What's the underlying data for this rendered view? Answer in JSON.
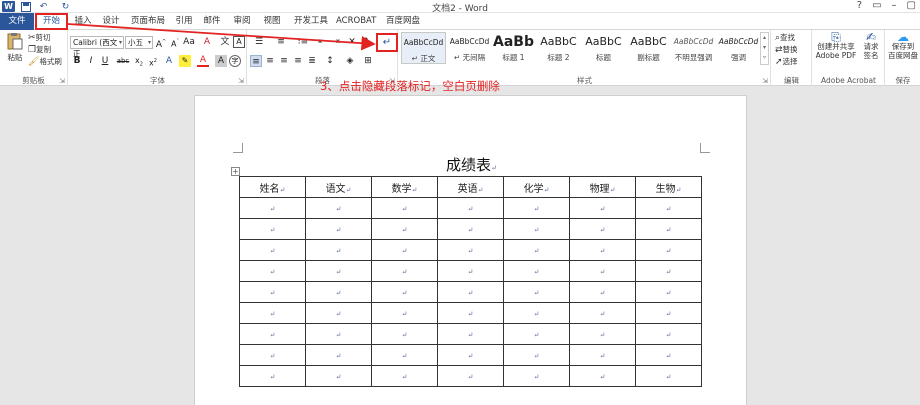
{
  "titlebar": {
    "app_icon_label": "W",
    "title": "文档2 - Word",
    "controls": [
      "?",
      "▭",
      "–",
      "▢"
    ]
  },
  "tabs": [
    {
      "label": "文件"
    },
    {
      "label": "开始"
    },
    {
      "label": "插入"
    },
    {
      "label": "设计"
    },
    {
      "label": "页面布局"
    },
    {
      "label": "引用"
    },
    {
      "label": "邮件"
    },
    {
      "label": "审阅"
    },
    {
      "label": "视图"
    },
    {
      "label": "开发工具"
    },
    {
      "label": "ACROBAT"
    },
    {
      "label": "百度网盘"
    }
  ],
  "clipboard": {
    "paste_label": "粘贴",
    "cut_label": "剪切",
    "copy_label": "复制",
    "format_painter_label": "格式刷",
    "group_label": "剪贴板"
  },
  "font": {
    "font_name": "Calibri (西文正",
    "font_size": "小五",
    "group_label": "字体"
  },
  "paragraph": {
    "group_label": "段落"
  },
  "styles": {
    "group_label": "样式",
    "items": [
      {
        "sample": "AaBbCcDd",
        "name": "↵ 正文"
      },
      {
        "sample": "AaBbCcDd",
        "name": "↵ 无间隔"
      },
      {
        "sample": "AaBb",
        "name": "标题 1"
      },
      {
        "sample": "AaBbC",
        "name": "标题 2"
      },
      {
        "sample": "AaBbC",
        "name": "标题"
      },
      {
        "sample": "AaBbC",
        "name": "副标题"
      },
      {
        "sample": "AaBbCcDd",
        "name": "不明显强调"
      },
      {
        "sample": "AaBbCcDd",
        "name": "强调"
      }
    ]
  },
  "editing": {
    "find_label": "查找",
    "replace_label": "替换",
    "select_label": "选择",
    "group_label": "编辑"
  },
  "acrobat": {
    "create_pdf_line1": "创建并共享",
    "create_pdf_line2": "Adobe PDF",
    "request_sign_line1": "请求",
    "request_sign_line2": "签名",
    "group_label": "Adobe Acrobat"
  },
  "save": {
    "button_line1": "保存到",
    "button_line2": "百度网盘",
    "group_label": "保存"
  },
  "annotation": "3、点击隐藏段落标记，空白页删除",
  "document": {
    "table_title": "成绩表",
    "headers": [
      "姓名",
      "语文",
      "数学",
      "英语",
      "化学",
      "物理",
      "生物"
    ],
    "empty_rows": 9,
    "return_mark": "↵"
  },
  "colors": {
    "accent": "#2b579a",
    "highlight_red": "#e32222"
  }
}
